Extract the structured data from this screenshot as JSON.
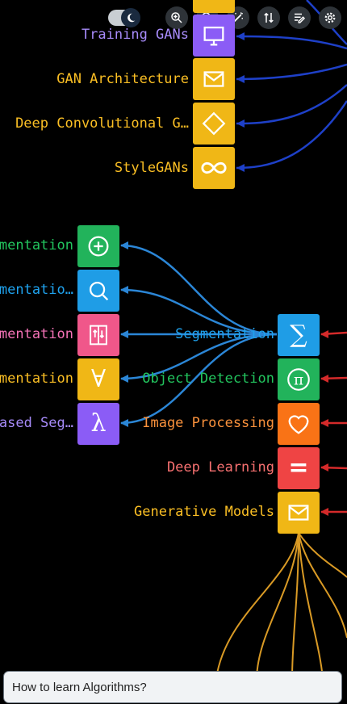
{
  "toolbar": {
    "icons": [
      "theme-toggle",
      "moon-icon",
      "zoom-in-icon",
      "zoom-out-icon",
      "magic-wand-icon",
      "sort-icon",
      "edit-list-icon",
      "gear-icon"
    ]
  },
  "colors": {
    "purple": "#8b5cf6",
    "yellow": "#fbbf24",
    "amber": "#f0b716",
    "green": "#22b35b",
    "blue": "#1f9de6",
    "pink": "#f0578a",
    "orange": "#f97316",
    "red": "#ef4444",
    "edge_dark_blue": "#1e40c8",
    "edge_blue": "#2b86d6",
    "edge_red": "#d42a2a",
    "edge_orange": "#d99a25"
  },
  "nodes": {
    "training_gans": {
      "label": "Training GANs",
      "icon": "monitor-icon"
    },
    "gan_architecture": {
      "label": "GAN Architecture",
      "icon": "mail-icon"
    },
    "deep_conv": {
      "label": "Deep Convolutional G…",
      "icon": "diamond-icon"
    },
    "stylegans": {
      "label": "StyleGANs",
      "icon": "infinity-icon"
    },
    "seg_a": {
      "label": "mentation",
      "icon": "plus-circle-icon"
    },
    "seg_b": {
      "label": "mentatio…",
      "icon": "search-icon"
    },
    "seg_c": {
      "label": "mentation",
      "icon": "swap-arrows-icon"
    },
    "seg_d": {
      "label": "mentation",
      "icon": "for-all-icon",
      "glyph": "∀"
    },
    "seg_e": {
      "label": "ased Seg…",
      "icon": "lambda-icon",
      "glyph": "λ"
    },
    "segmentation": {
      "label": "Segmentation",
      "icon": "sigma-icon",
      "glyph": "∑"
    },
    "object_detection": {
      "label": "Object Detection",
      "icon": "pi-circle-icon",
      "glyph": "π"
    },
    "image_processing": {
      "label": "Image Processing",
      "icon": "heart-icon"
    },
    "deep_learning": {
      "label": "Deep Learning",
      "icon": "equals-icon",
      "glyph": "="
    },
    "generative_models": {
      "label": "Generative Models",
      "icon": "mail-icon"
    }
  },
  "chat": {
    "text": "How to learn Algorithms?"
  }
}
